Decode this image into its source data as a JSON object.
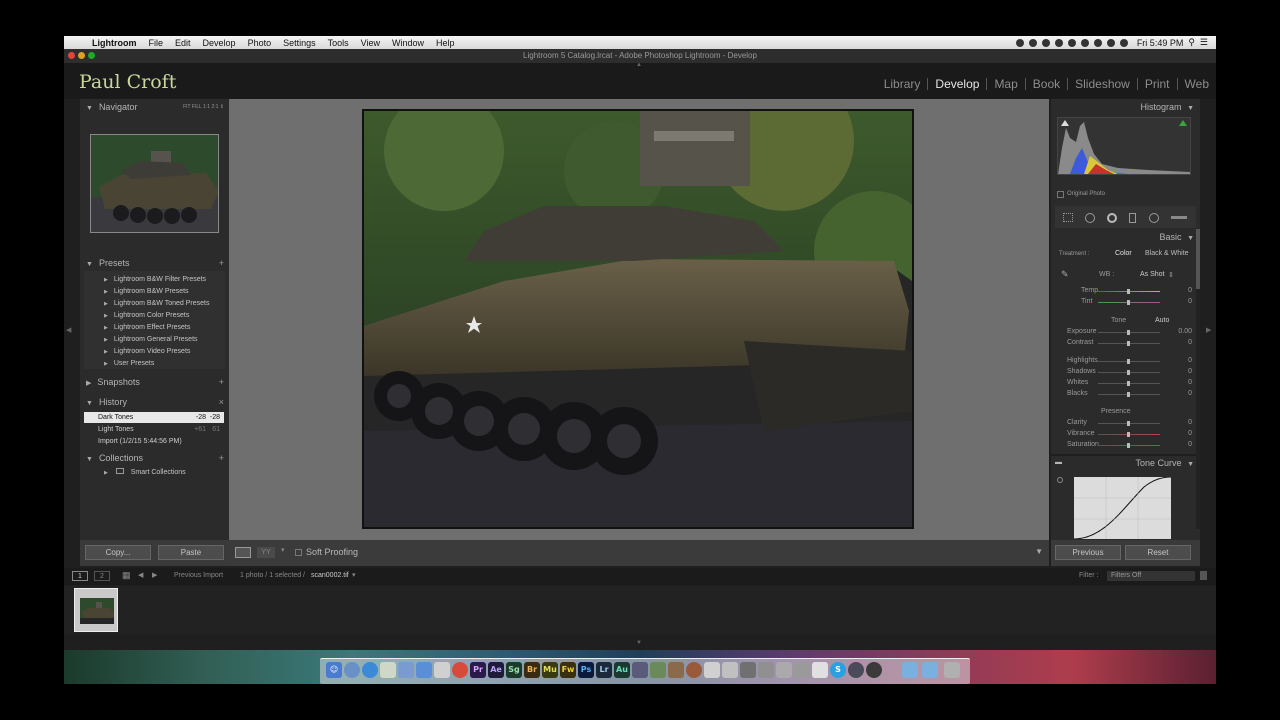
{
  "menubar": {
    "app": "Lightroom",
    "items": [
      "File",
      "Edit",
      "Develop",
      "Photo",
      "Settings",
      "Tools",
      "View",
      "Window",
      "Help"
    ],
    "clock": "Fri 5:49 PM"
  },
  "window_title": "Lightroom 5 Catalog.lrcat - Adobe Photoshop Lightroom - Develop",
  "identity_plate": "Paul Croft",
  "modules": [
    "Library",
    "Develop",
    "Map",
    "Book",
    "Slideshow",
    "Print",
    "Web"
  ],
  "navigator": {
    "title": "Navigator",
    "zoom_options": [
      "FIT",
      "FILL",
      "1:1",
      "2:1"
    ]
  },
  "presets": {
    "title": "Presets",
    "items": [
      "Lightroom B&W Filter Presets",
      "Lightroom B&W Presets",
      "Lightroom B&W Toned Presets",
      "Lightroom Color Presets",
      "Lightroom Effect Presets",
      "Lightroom General Presets",
      "Lightroom Video Presets",
      "User Presets"
    ]
  },
  "snapshots": {
    "title": "Snapshots"
  },
  "history": {
    "title": "History",
    "items": [
      {
        "label": "Dark Tones",
        "v1": "-28",
        "v2": "-28"
      },
      {
        "label": "Light Tones",
        "v1": "+61",
        "v2": "61"
      },
      {
        "label": "Import (1/2/15 5:44:56 PM)",
        "v1": "",
        "v2": ""
      }
    ]
  },
  "collections": {
    "title": "Collections",
    "items": [
      "Smart Collections"
    ]
  },
  "left_buttons": {
    "copy": "Copy...",
    "paste": "Paste"
  },
  "toolbar": {
    "soft_proofing": "Soft Proofing"
  },
  "histogram": {
    "title": "Histogram",
    "original_photo": "Original Photo"
  },
  "basic": {
    "title": "Basic",
    "treatment_label": "Treatment :",
    "color": "Color",
    "bw": "Black & White",
    "wb_label": "WB :",
    "wb_value": "As Shot",
    "tone": "Tone",
    "auto": "Auto",
    "presence": "Presence",
    "sliders": [
      {
        "label": "Temp",
        "value": "0"
      },
      {
        "label": "Tint",
        "value": "0"
      },
      {
        "label": "Exposure",
        "value": "0.00"
      },
      {
        "label": "Contrast",
        "value": "0"
      },
      {
        "label": "Highlights",
        "value": "0"
      },
      {
        "label": "Shadows",
        "value": "0"
      },
      {
        "label": "Whites",
        "value": "0"
      },
      {
        "label": "Blacks",
        "value": "0"
      },
      {
        "label": "Clarity",
        "value": "0"
      },
      {
        "label": "Vibrance",
        "value": "0"
      },
      {
        "label": "Saturation",
        "value": "0"
      }
    ]
  },
  "tone_curve": {
    "title": "Tone Curve"
  },
  "right_buttons": {
    "previous": "Previous",
    "reset": "Reset"
  },
  "filmbar": {
    "page1": "1",
    "page2": "2",
    "source": "Previous Import",
    "info": "1 photo / 1 selected /",
    "filename": "scan0002.tif",
    "filter_label": "Filter :",
    "filter_value": "Filters Off"
  },
  "dock_labels": [
    "Pr",
    "Ae",
    "Sg",
    "Br",
    "Mu",
    "Fw",
    "Ps",
    "Lr",
    "Au"
  ],
  "colors": {
    "identity": "#c8d89a",
    "panel": "#2b2b2b",
    "canvas": "#6f6f6f"
  }
}
